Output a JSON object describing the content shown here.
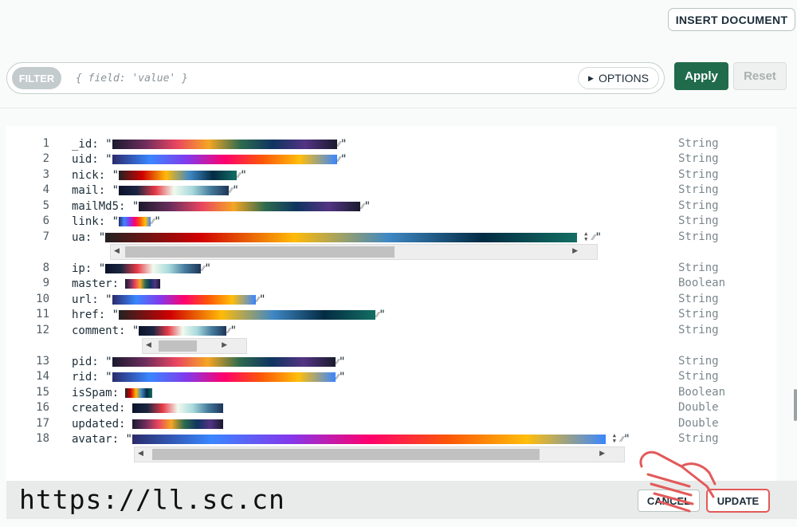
{
  "header": {
    "insert_label": "INSERT DOCUMENT"
  },
  "filter": {
    "pill_label": "FILTER",
    "placeholder": "{ field: 'value' }",
    "options_label": "OPTIONS",
    "apply_label": "Apply",
    "reset_label": "Reset"
  },
  "document": {
    "fields": [
      {
        "num": "1",
        "key": "_id:",
        "type": "String",
        "kind": "string"
      },
      {
        "num": "2",
        "key": "uid:",
        "type": "String",
        "kind": "string"
      },
      {
        "num": "3",
        "key": "nick:",
        "type": "String",
        "kind": "string"
      },
      {
        "num": "4",
        "key": "mail:",
        "type": "String",
        "kind": "string"
      },
      {
        "num": "5",
        "key": "mailMd5:",
        "type": "String",
        "kind": "string"
      },
      {
        "num": "6",
        "key": "link:",
        "type": "String",
        "kind": "string"
      },
      {
        "num": "7",
        "key": "ua:",
        "type": "String",
        "kind": "string"
      },
      {
        "num": "8",
        "key": "ip:",
        "type": "String",
        "kind": "string"
      },
      {
        "num": "9",
        "key": "master:",
        "type": "Boolean",
        "kind": "plain"
      },
      {
        "num": "10",
        "key": "url:",
        "type": "String",
        "kind": "string"
      },
      {
        "num": "11",
        "key": "href:",
        "type": "String",
        "kind": "string"
      },
      {
        "num": "12",
        "key": "comment:",
        "type": "String",
        "kind": "string"
      },
      {
        "num": "13",
        "key": "pid:",
        "type": "String",
        "kind": "string"
      },
      {
        "num": "14",
        "key": "rid:",
        "type": "String",
        "kind": "string"
      },
      {
        "num": "15",
        "key": "isSpam:",
        "type": "Boolean",
        "kind": "plain"
      },
      {
        "num": "16",
        "key": "created:",
        "type": "Double",
        "kind": "plain"
      },
      {
        "num": "17",
        "key": "updated:",
        "type": "Double",
        "kind": "plain"
      },
      {
        "num": "18",
        "key": "avatar:",
        "type": "String",
        "kind": "string"
      }
    ]
  },
  "footer": {
    "watermark": "https://ll.sc.cn",
    "cancel_label": "CANCEL",
    "update_label": "UPDATE"
  },
  "colors": {
    "apply_bg": "#206b4b",
    "highlight": "#e25a5a"
  }
}
